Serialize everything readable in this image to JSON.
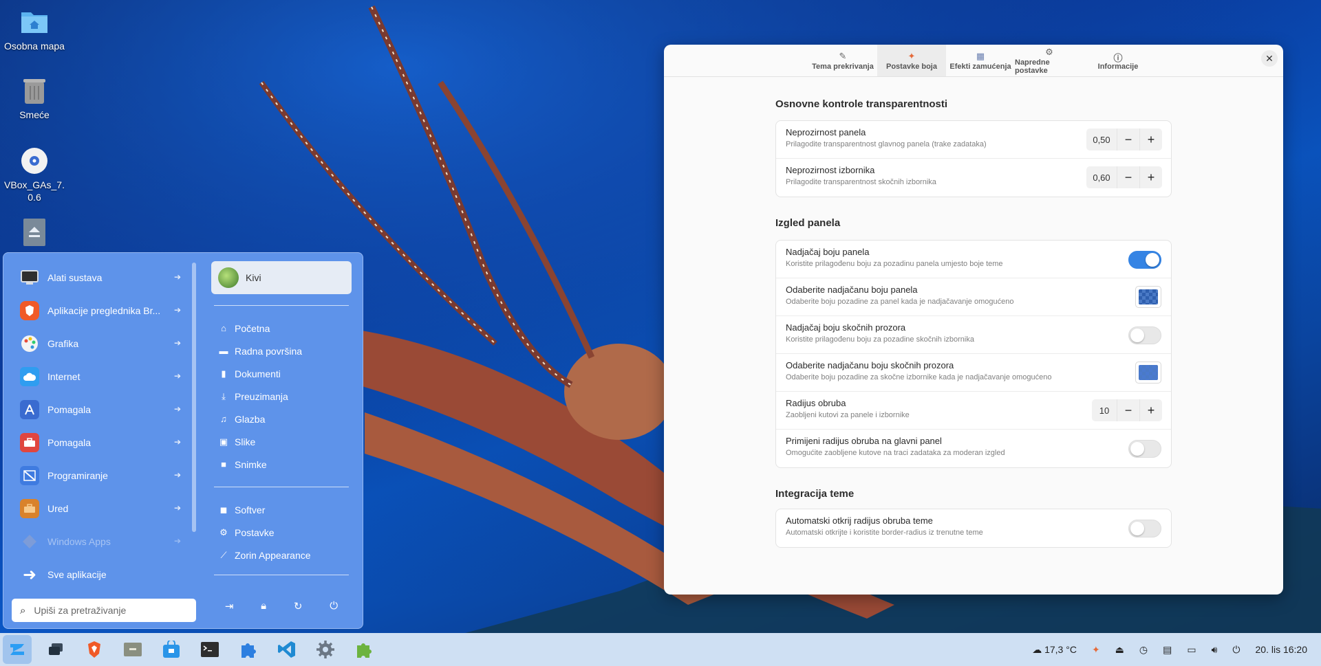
{
  "desktop": {
    "icons": [
      {
        "label": "Osobna mapa",
        "icon": "home-folder-icon"
      },
      {
        "label": "Smeće",
        "icon": "trash-icon"
      },
      {
        "label": "VBox_GAs_7.0.6",
        "label_line1": "VBox_GAs_7.",
        "label_line2": "0.6",
        "icon": "optical-disc-icon"
      },
      {
        "label": "",
        "icon": "eject-drive-icon"
      }
    ]
  },
  "start_menu": {
    "categories": [
      {
        "label": "Alati sustava",
        "icon": "monitor-icon",
        "color": "#d9dde3"
      },
      {
        "label": "Aplikacije preglednika Br...",
        "icon": "brave-icon",
        "color": "#f05a28"
      },
      {
        "label": "Grafika",
        "icon": "palette-icon",
        "color": "#f4f4f4"
      },
      {
        "label": "Internet",
        "icon": "cloud-icon",
        "color": "#2f9df0"
      },
      {
        "label": "Pomagala",
        "icon": "compass-icon",
        "color": "#3a6bd0"
      },
      {
        "label": "Pomagala",
        "icon": "toolbox-icon",
        "color": "#e0463f"
      },
      {
        "label": "Programiranje",
        "icon": "code-icon",
        "color": "#3f7be0"
      },
      {
        "label": "Ured",
        "icon": "briefcase-icon",
        "color": "#d9822b"
      },
      {
        "label": "Windows Apps",
        "icon": "windows-icon",
        "color": "#8a9fd0"
      },
      {
        "label": "Sve aplikacije",
        "icon": "arrow-right-icon",
        "color": ""
      }
    ],
    "user": {
      "name": "Kivi"
    },
    "places": [
      {
        "label": "Početna",
        "icon": "home-icon"
      },
      {
        "label": "Radna površina",
        "icon": "desktop-icon"
      },
      {
        "label": "Dokumenti",
        "icon": "document-icon"
      },
      {
        "label": "Preuzimanja",
        "icon": "download-icon"
      },
      {
        "label": "Glazba",
        "icon": "music-icon"
      },
      {
        "label": "Slike",
        "icon": "image-icon"
      },
      {
        "label": "Snimke",
        "icon": "video-icon"
      }
    ],
    "apps": [
      {
        "label": "Softver",
        "icon": "software-bag-icon"
      },
      {
        "label": "Postavke",
        "icon": "gear-icon"
      },
      {
        "label": "Zorin Appearance",
        "icon": "appearance-icon"
      }
    ],
    "search_placeholder": "Upiši za pretraživanje"
  },
  "taskbar": {
    "weather": "17,3 °C",
    "datetime": "20. lis 16:20"
  },
  "window": {
    "tabs": [
      {
        "label": "Tema prekrivanja",
        "icon": "brush-icon"
      },
      {
        "label": "Postavke boja",
        "icon": "color-icon"
      },
      {
        "label": "Efekti zamućenja",
        "icon": "blur-icon"
      },
      {
        "label": "Napredne postavke",
        "icon": "advanced-icon"
      },
      {
        "label": "Informacije",
        "icon": "info-icon"
      }
    ],
    "active_tab": "Postavke boja",
    "sections": [
      {
        "title": "Osnovne kontrole transparentnosti",
        "rows": [
          {
            "title": "Neprozirnost panela",
            "subtitle": "Prilagodite transparentnost glavnog panela (trake zadataka)",
            "control": "spin",
            "value": "0,50"
          },
          {
            "title": "Neprozirnost izbornika",
            "subtitle": "Prilagodite transparentnost skočnih izbornika",
            "control": "spin",
            "value": "0,60"
          }
        ]
      },
      {
        "title": "Izgled panela",
        "rows": [
          {
            "title": "Nadjačaj boju panela",
            "subtitle": "Koristite prilagođenu boju za pozadinu panela umjesto boje teme",
            "control": "toggle",
            "on": true
          },
          {
            "title": "Odaberite nadjačanu boju panela",
            "subtitle": "Odaberite boju pozadine za panel kada je nadjačavanje omogućeno",
            "control": "color"
          },
          {
            "title": "Nadjačaj boju skočnih prozora",
            "subtitle": "Koristite prilagođenu boju za pozadine skočnih izbornika",
            "control": "toggle",
            "on": false
          },
          {
            "title": "Odaberite nadjačanu boju skočnih prozora",
            "subtitle": "Odaberite boju pozadine za skočne izbornike kada je nadjačavanje omogućeno",
            "control": "color"
          },
          {
            "title": "Radijus obruba",
            "subtitle": "Zaobljeni kutovi za panele i izbornike",
            "control": "spin",
            "value": "10"
          },
          {
            "title": "Primijeni radijus obruba na glavni panel",
            "subtitle": "Omogućite zaobljene kutove na traci zadataka za moderan izgled",
            "control": "toggle",
            "on": false
          }
        ]
      },
      {
        "title": "Integracija teme",
        "rows": [
          {
            "title": "Automatski otkrij radijus obruba teme",
            "subtitle": "Automatski otkrijte i koristite border-radius iz trenutne teme",
            "control": "toggle",
            "on": false
          }
        ]
      }
    ]
  }
}
